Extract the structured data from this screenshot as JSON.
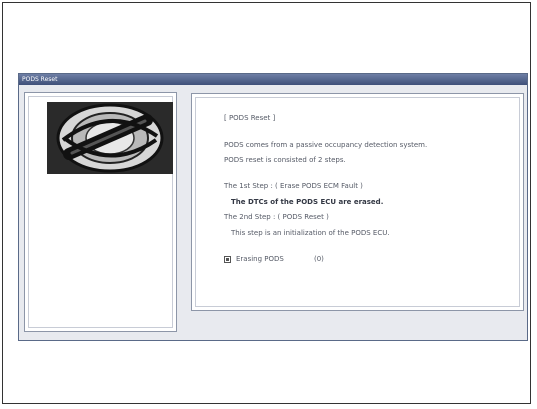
{
  "window": {
    "title": "PODS Reset"
  },
  "content": {
    "heading": "[ PODS Reset ]",
    "line1": "PODS comes from a passive occupancy detection system.",
    "line2": "PODS reset is consisted of 2 steps.",
    "step1_title": "The 1st Step : ( Erase PODS ECM Fault )",
    "step1_desc": "The DTCs of the PODS ECU are erased.",
    "step2_title": "The 2nd Step : ( PODS Reset )",
    "step2_desc": "This step is an initialization of the PODS ECU.",
    "erasing_label": "Erasing PODS",
    "erasing_count": "(0)"
  },
  "icons": {
    "checkbox_left": "checkbox-icon",
    "checkbox_right": "checkbox-icon"
  },
  "colors": {
    "titlebar": "#3f5079",
    "panel_border": "#8d96a8"
  }
}
